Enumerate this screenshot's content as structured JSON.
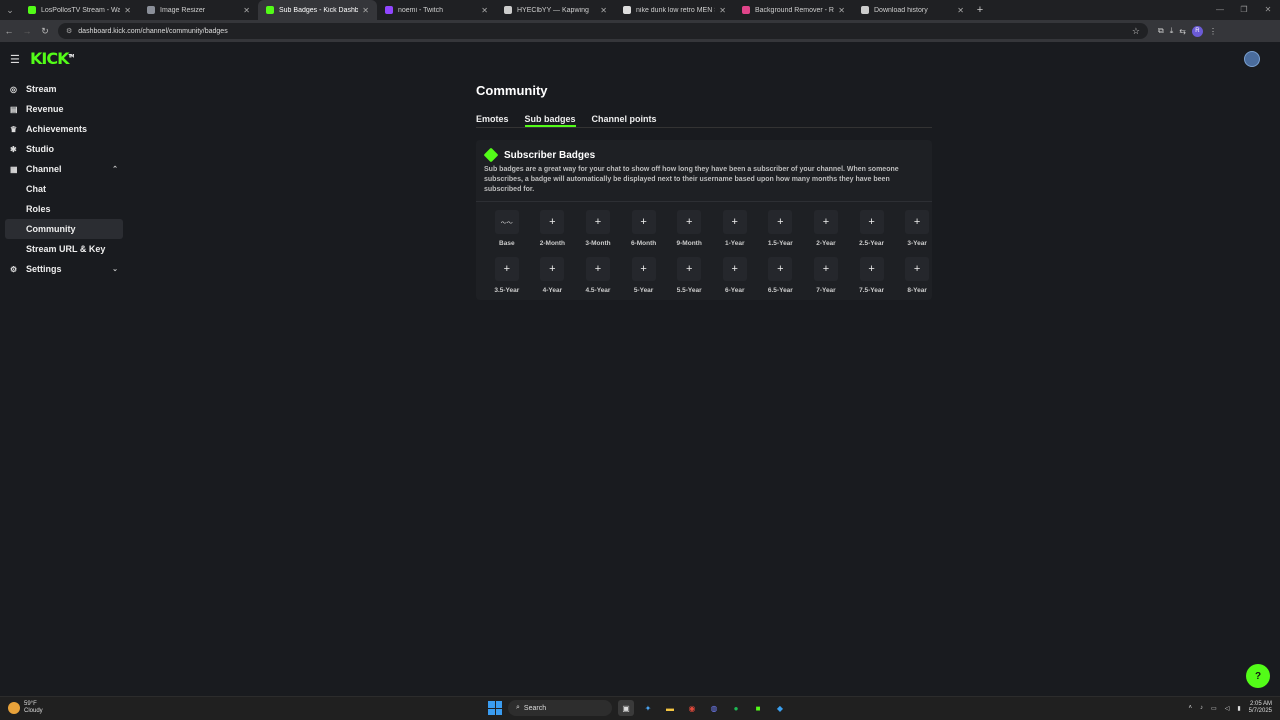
{
  "browser": {
    "tabs": [
      {
        "title": "LosPollosTV Stream - Watch Li",
        "color": "#53fc18"
      },
      {
        "title": "Image Resizer",
        "color": "#8a8f99"
      },
      {
        "title": "Sub Badges - Kick Dashboard",
        "color": "#53fc18",
        "active": true
      },
      {
        "title": "noemi - Twitch",
        "color": "#9146ff"
      },
      {
        "title": "HYEClbYY — Kapwing",
        "color": "#cccccc"
      },
      {
        "title": "nike dunk low retro MEN SHOE",
        "color": "#dddddd"
      },
      {
        "title": "Background Remover - Remove",
        "color": "#e0458a"
      },
      {
        "title": "Download history",
        "color": "#cccccc"
      }
    ],
    "url": "dashboard.kick.com/channel/community/badges"
  },
  "brand": {
    "logo": "KICK",
    "logo_tm": "TM",
    "accent": "#53fc18"
  },
  "sidebar": {
    "items": [
      {
        "label": "Stream",
        "icon": "broadcast-icon"
      },
      {
        "label": "Revenue",
        "icon": "wallet-icon"
      },
      {
        "label": "Achievements",
        "icon": "trophy-icon"
      },
      {
        "label": "Studio",
        "icon": "studio-icon"
      },
      {
        "label": "Channel",
        "icon": "channel-icon",
        "expanded": true
      },
      {
        "label": "Chat",
        "sub": true
      },
      {
        "label": "Roles",
        "sub": true
      },
      {
        "label": "Community",
        "sub": true,
        "active": true
      },
      {
        "label": "Stream URL & Key",
        "sub": true
      },
      {
        "label": "Settings",
        "icon": "gear-icon",
        "expanded": false
      }
    ]
  },
  "main": {
    "title": "Community",
    "tabs": [
      "Emotes",
      "Sub badges",
      "Channel points"
    ],
    "active_tab": "Sub badges",
    "card": {
      "title": "Subscriber Badges",
      "description": "Sub badges are a great way for your chat to show off how long they have been a subscriber of your channel. When someone subscribes, a badge will automatically be displayed next to their username based upon how many months they have been subscribed for.",
      "badges": [
        "Base",
        "2-Month",
        "3-Month",
        "6-Month",
        "9-Month",
        "1-Year",
        "1.5-Year",
        "2-Year",
        "2.5-Year",
        "3-Year",
        "3.5-Year",
        "4-Year",
        "4.5-Year",
        "5-Year",
        "5.5-Year",
        "6-Year",
        "6.5-Year",
        "7-Year",
        "7.5-Year",
        "8-Year"
      ]
    }
  },
  "taskbar": {
    "temp": "59°F",
    "weather": "Cloudy",
    "search_placeholder": "Search",
    "time": "2:05 AM",
    "date": "5/7/2025"
  }
}
